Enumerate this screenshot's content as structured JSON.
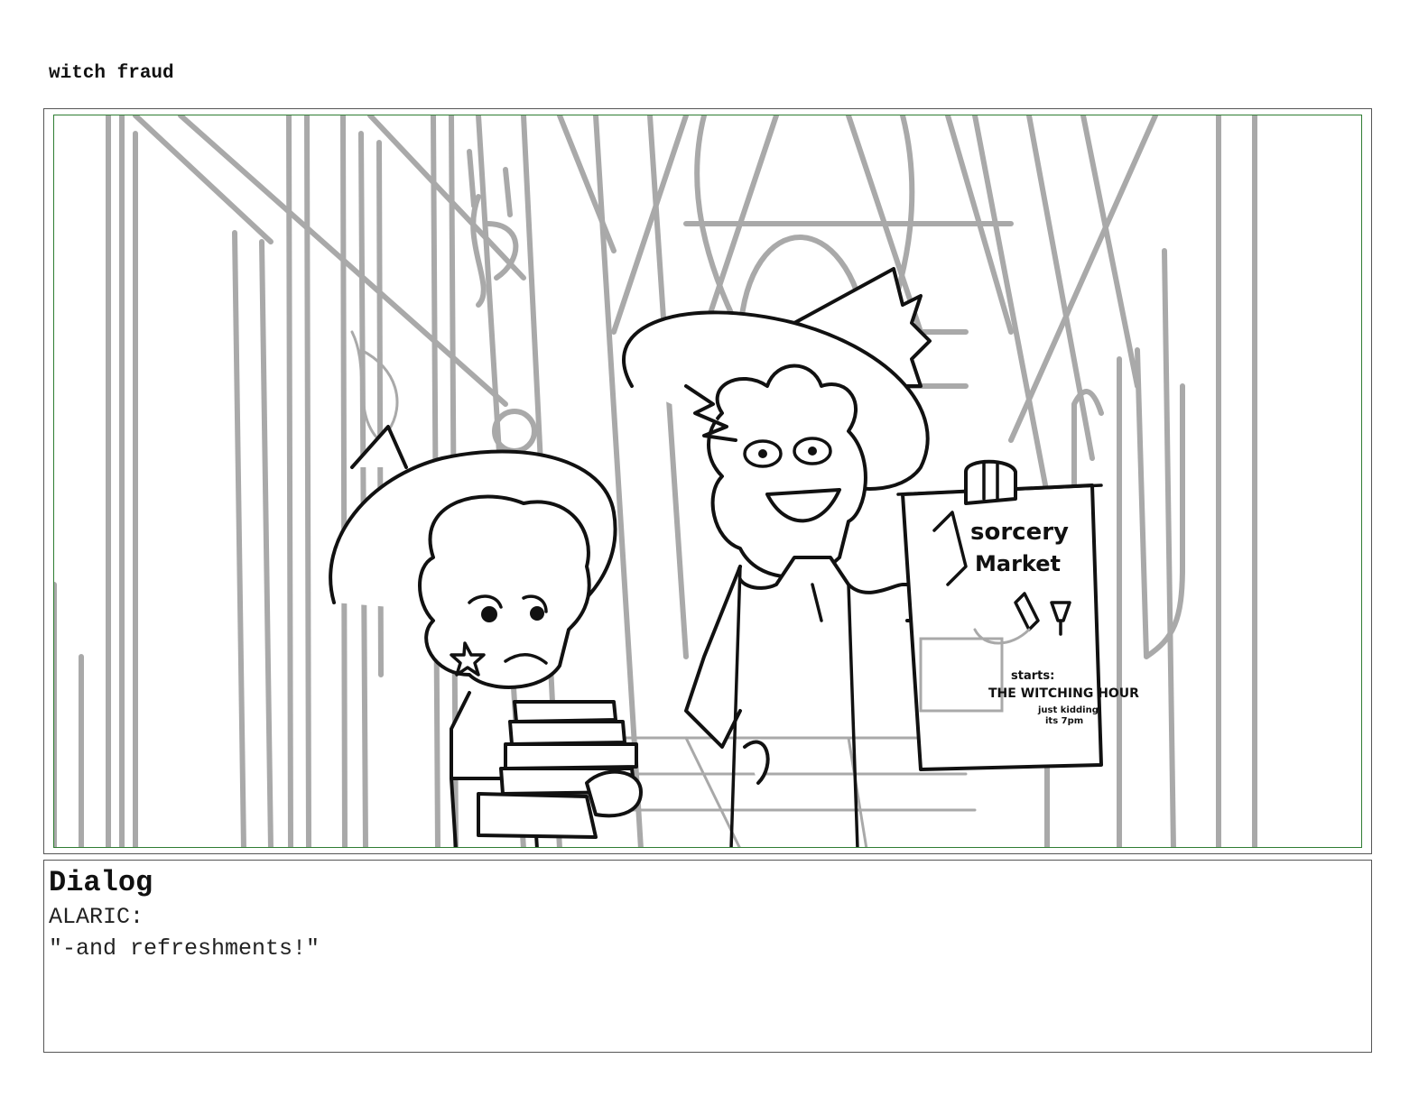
{
  "document": {
    "title": "witch fraud"
  },
  "panel": {
    "poster": {
      "line1": "sorcery",
      "line2": "Market",
      "line3": "starts:",
      "line4": "THE WITCHING HOUR",
      "line5": "just kidding",
      "line6": "its 7pm"
    }
  },
  "dialog": {
    "heading": "Dialog",
    "speaker": "ALARIC:",
    "line": "\"-and refreshments!\""
  }
}
